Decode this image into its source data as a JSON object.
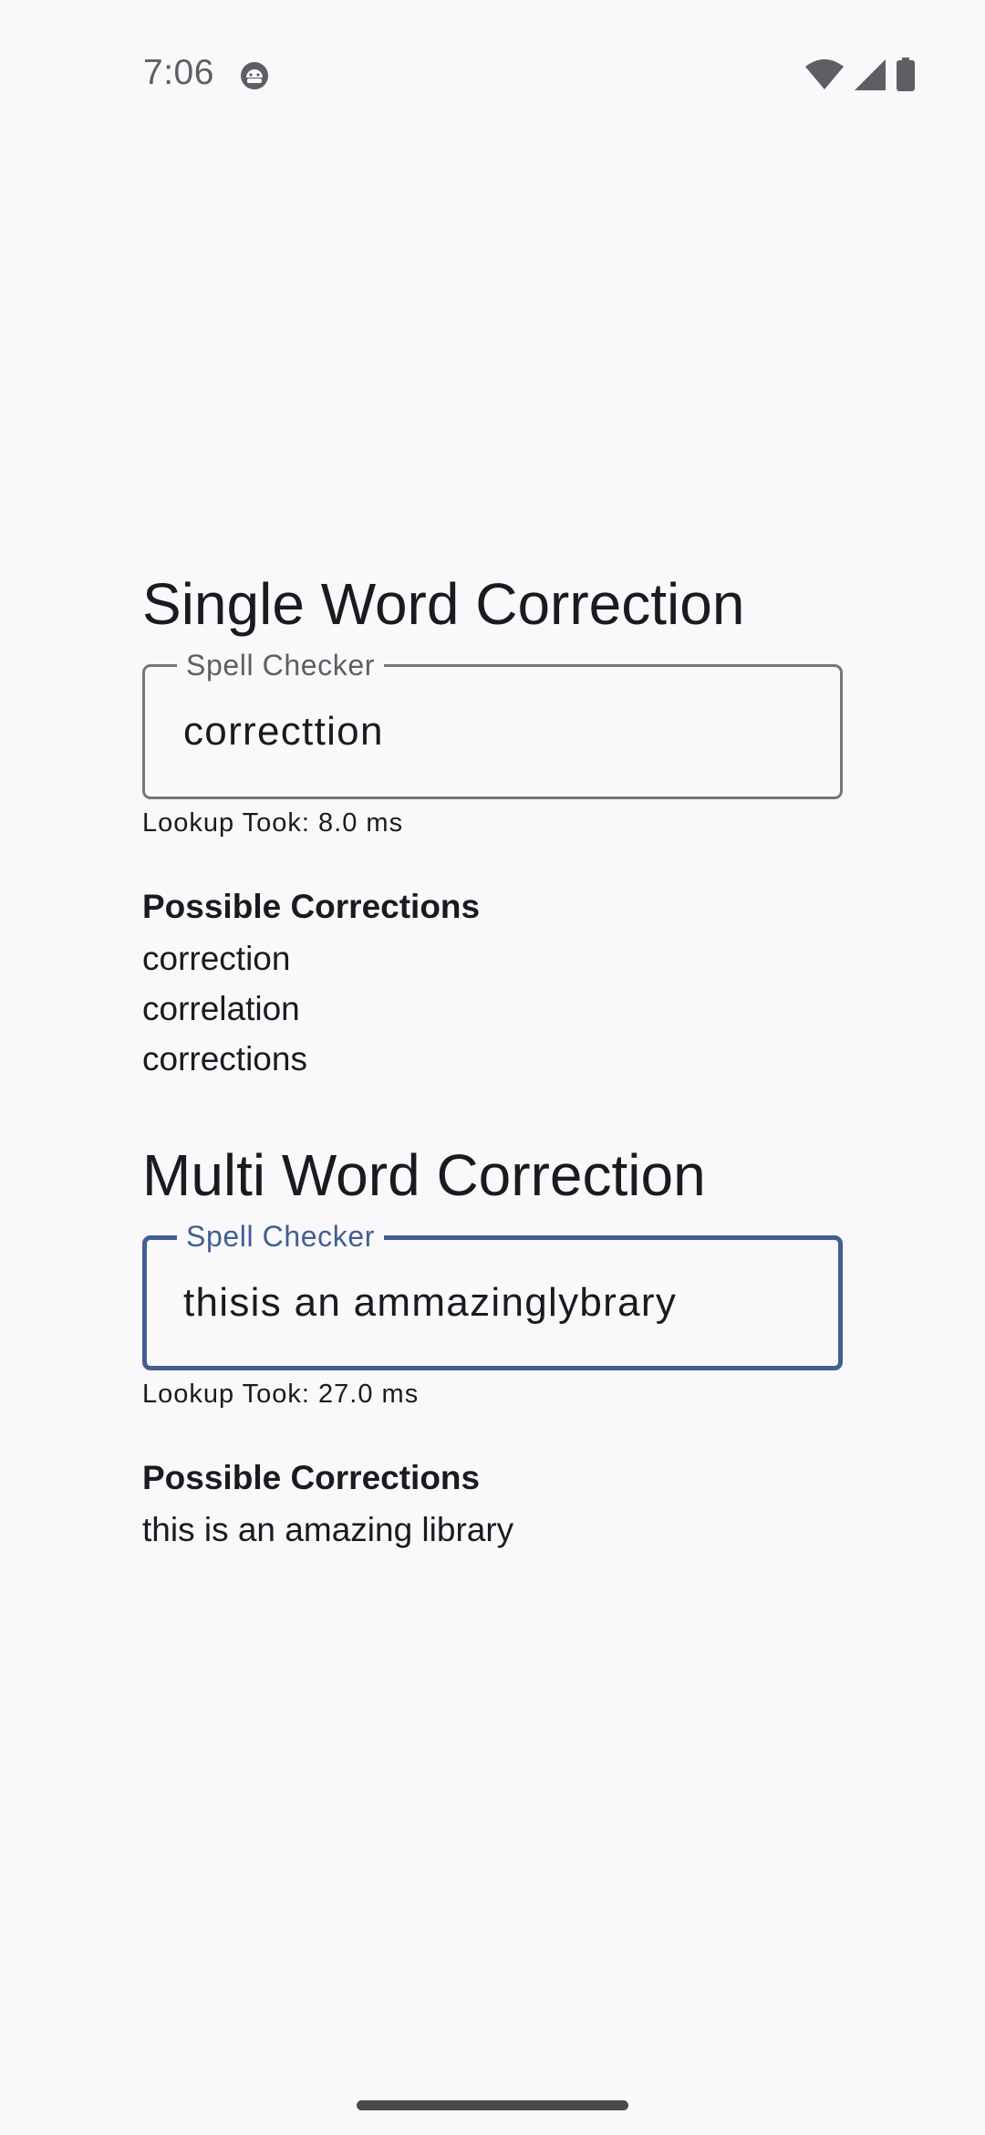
{
  "status_bar": {
    "time": "7:06",
    "app_icon": "android-head-icon",
    "icons": [
      "wifi-icon",
      "cellular-signal-icon",
      "battery-icon"
    ]
  },
  "single": {
    "title": "Single Word Correction",
    "field_label": "Spell Checker",
    "field_value": "correcttion",
    "lookup": "Lookup Took: 8.0 ms",
    "corrections_title": "Possible Corrections",
    "corrections": [
      "correction",
      "correlation",
      "corrections"
    ]
  },
  "multi": {
    "title": "Multi Word Correction",
    "field_label": "Spell Checker",
    "field_value": "thisis an ammazinglybrary",
    "lookup": "Lookup Took: 27.0 ms",
    "corrections_title": "Possible Corrections",
    "corrections": [
      "this is an amazing library"
    ]
  },
  "colors": {
    "focus": "#445e91",
    "outline": "#75757a",
    "background": "#f9f9fb"
  }
}
